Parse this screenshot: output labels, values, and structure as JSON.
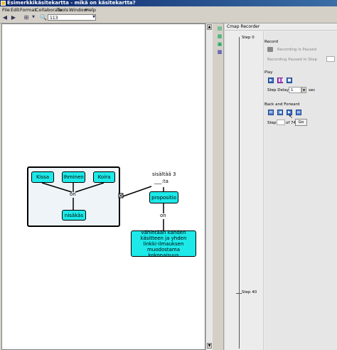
{
  "window": {
    "title": "Esimerkkikäsitekartta - mikä on käsitekartta?"
  },
  "menu": [
    "File",
    "Edit",
    "Format",
    "Collaborate",
    "Tools",
    "Window",
    "Help"
  ],
  "toolbar": {
    "zoom_value": "113"
  },
  "recorder": {
    "title": "Cmap Recorder",
    "record_header": "Record",
    "recording_status": "Recording is Paused",
    "recording_paused_label": "Recording Paused in Step",
    "play_header": "Play",
    "step_delay_label": "Step Delay",
    "step_delay_value": "1",
    "step_delay_unit": "sec",
    "back_forward_header": "Back and Forward",
    "step_label": "Step",
    "of_label": "of 74",
    "go_label": "Go",
    "timeline": {
      "step0": "Step 0",
      "step40": "Step 40"
    }
  },
  "conceptmap": {
    "nodes": {
      "kissa": "Kissa",
      "ihminen": "Ihminen",
      "koira": "Koira",
      "nisakas": "nisäkäs",
      "propositio": "propositio",
      "vahintaan": "vähintään kahden käsitteen ja yhden linkki-ilmauksen muodostama kokonaisuus"
    },
    "links": {
      "on1": "on",
      "sisaltaa": "sisältää 3",
      "ta": "___:ta",
      "on2": "on"
    },
    "colors": {
      "node_fill": "#1de9e9",
      "group_fill": "#eef4f7"
    }
  }
}
